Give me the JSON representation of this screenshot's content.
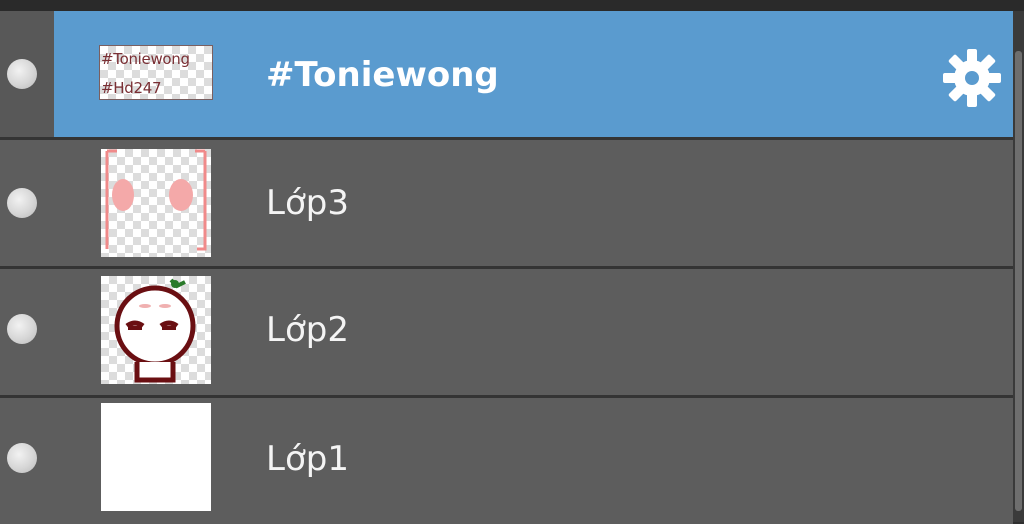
{
  "layers": [
    {
      "name": "#Toniewong",
      "selected": true,
      "visible": true,
      "thumbnail": {
        "kind": "text",
        "lines": [
          "#Toniewong",
          "#Hd247"
        ]
      },
      "settings_icon": "gear-icon"
    },
    {
      "name": "Lớp3",
      "selected": false,
      "visible": true,
      "thumbnail": {
        "kind": "blush-marks"
      }
    },
    {
      "name": "Lớp2",
      "selected": false,
      "visible": true,
      "thumbnail": {
        "kind": "character-sketch"
      }
    },
    {
      "name": "Lớp1",
      "selected": false,
      "visible": true,
      "thumbnail": {
        "kind": "white-fill"
      }
    }
  ],
  "colors": {
    "selected_row": "#5a9bcf",
    "row": "#5d5d5d",
    "divider": "#343434",
    "label": "#f4f4f4"
  }
}
